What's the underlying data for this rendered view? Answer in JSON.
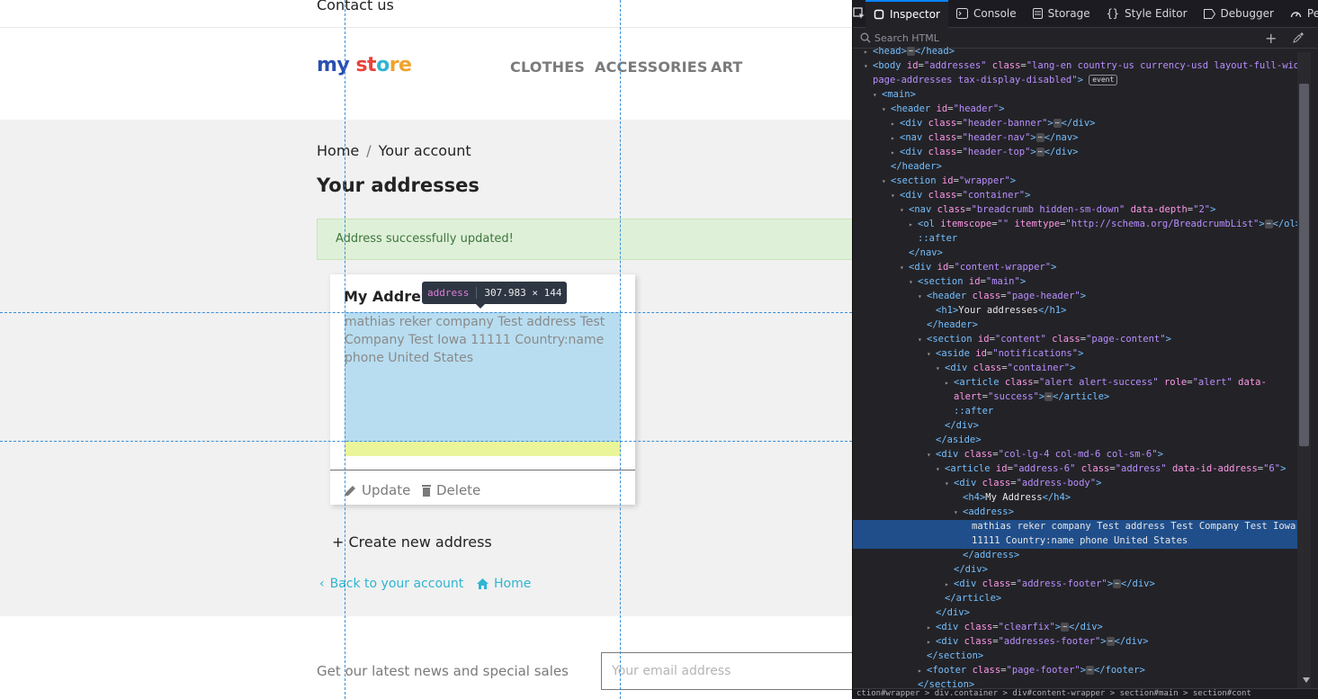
{
  "site": {
    "contact": "Contact us",
    "logo": {
      "part1": "my",
      "part2": "st",
      "part3": "o",
      "part4": "re"
    },
    "menu": [
      "CLOTHES",
      "ACCESSORIES",
      "ART"
    ],
    "breadcrumb": {
      "home": "Home",
      "sep": "/",
      "current": "Your account"
    },
    "page_title": "Your addresses",
    "alert": "Address successfully updated!",
    "address_card": {
      "title": "My Address",
      "body": "mathias reker company Test address Test Company Test Iowa 11111 Country:name phone United States",
      "update": "Update",
      "delete": "Delete"
    },
    "create_new": "Create new address",
    "back_link": "Back to your account",
    "home_link": "Home",
    "newsletter": "Get our latest news and special sales",
    "email_placeholder": "Your email address"
  },
  "overlay": {
    "tooltip_tag": "address",
    "tooltip_dims": "307.983 × 144"
  },
  "devtools": {
    "tabs": [
      "Inspector",
      "Console",
      "Storage",
      "Style Editor",
      "Debugger",
      "Perf"
    ],
    "search_placeholder": "Search HTML",
    "breadcrumb_bar": "ction#wrapper > div.container > div#content-wrapper > section#main > section#cont",
    "tree": [
      {
        "indent": 1,
        "tw": "▸",
        "html": "<span class='tg'>&lt;head&gt;</span><span class='dots'>⋯</span><span class='tg'>&lt;/head&gt;</span>"
      },
      {
        "indent": 1,
        "tw": "▾",
        "html": "<span class='tg'>&lt;body</span> <span class='an'>id</span>=<span class='av'>\"addresses\"</span> <span class='an'>class</span>=<span class='av'>\"lang-en country-us currency-usd layout-full-width</span>"
      },
      {
        "indent": 1,
        "tw": "",
        "html": "<span class='av'>page-addresses tax-display-disabled\"</span><span class='tg'>&gt;</span> <span class='badge'>event</span>"
      },
      {
        "indent": 2,
        "tw": "▾",
        "html": "<span class='tg'>&lt;main&gt;</span>"
      },
      {
        "indent": 3,
        "tw": "▾",
        "html": "<span class='tg'>&lt;header</span> <span class='an'>id</span>=<span class='av'>\"header\"</span><span class='tg'>&gt;</span>"
      },
      {
        "indent": 4,
        "tw": "▸",
        "html": "<span class='tg'>&lt;div</span> <span class='an'>class</span>=<span class='av'>\"header-banner\"</span><span class='tg'>&gt;</span><span class='dots'>⋯</span><span class='tg'>&lt;/div&gt;</span>"
      },
      {
        "indent": 4,
        "tw": "▸",
        "html": "<span class='tg'>&lt;nav</span> <span class='an'>class</span>=<span class='av'>\"header-nav\"</span><span class='tg'>&gt;</span><span class='dots'>⋯</span><span class='tg'>&lt;/nav&gt;</span>"
      },
      {
        "indent": 4,
        "tw": "▸",
        "html": "<span class='tg'>&lt;div</span> <span class='an'>class</span>=<span class='av'>\"header-top\"</span><span class='tg'>&gt;</span><span class='dots'>⋯</span><span class='tg'>&lt;/div&gt;</span>"
      },
      {
        "indent": 3,
        "tw": "",
        "html": "<span class='tg'>&lt;/header&gt;</span>"
      },
      {
        "indent": 3,
        "tw": "▾",
        "html": "<span class='tg'>&lt;section</span> <span class='an'>id</span>=<span class='av'>\"wrapper\"</span><span class='tg'>&gt;</span>"
      },
      {
        "indent": 4,
        "tw": "▾",
        "html": "<span class='tg'>&lt;div</span> <span class='an'>class</span>=<span class='av'>\"container\"</span><span class='tg'>&gt;</span>"
      },
      {
        "indent": 5,
        "tw": "▾",
        "html": "<span class='tg'>&lt;nav</span> <span class='an'>class</span>=<span class='av'>\"breadcrumb hidden-sm-down\"</span> <span class='an'>data-depth</span>=<span class='av'>\"2\"</span><span class='tg'>&gt;</span>"
      },
      {
        "indent": 6,
        "tw": "▸",
        "html": "<span class='tg'>&lt;ol</span> <span class='an'>itemscope</span>=<span class='av'>\"\"</span> <span class='an'>itemtype</span>=<span class='av'>\"http://schema.org/BreadcrumbList\"</span><span class='tg'>&gt;</span><span class='dots'>⋯</span><span class='tg'>&lt;/ol&gt;</span>"
      },
      {
        "indent": 6,
        "tw": "",
        "html": "<span class='ps'>::after</span>"
      },
      {
        "indent": 5,
        "tw": "",
        "html": "<span class='tg'>&lt;/nav&gt;</span>"
      },
      {
        "indent": 5,
        "tw": "▾",
        "html": "<span class='tg'>&lt;div</span> <span class='an'>id</span>=<span class='av'>\"content-wrapper\"</span><span class='tg'>&gt;</span>"
      },
      {
        "indent": 6,
        "tw": "▾",
        "html": "<span class='tg'>&lt;section</span> <span class='an'>id</span>=<span class='av'>\"main\"</span><span class='tg'>&gt;</span>"
      },
      {
        "indent": 7,
        "tw": "▾",
        "html": "<span class='tg'>&lt;header</span> <span class='an'>class</span>=<span class='av'>\"page-header\"</span><span class='tg'>&gt;</span>"
      },
      {
        "indent": 8,
        "tw": "",
        "html": "<span class='tg'>&lt;h1&gt;</span><span class='tx'>Your addresses</span><span class='tg'>&lt;/h1&gt;</span>"
      },
      {
        "indent": 7,
        "tw": "",
        "html": "<span class='tg'>&lt;/header&gt;</span>"
      },
      {
        "indent": 7,
        "tw": "▾",
        "html": "<span class='tg'>&lt;section</span> <span class='an'>id</span>=<span class='av'>\"content\"</span> <span class='an'>class</span>=<span class='av'>\"page-content\"</span><span class='tg'>&gt;</span>"
      },
      {
        "indent": 8,
        "tw": "▾",
        "html": "<span class='tg'>&lt;aside</span> <span class='an'>id</span>=<span class='av'>\"notifications\"</span><span class='tg'>&gt;</span>"
      },
      {
        "indent": 9,
        "tw": "▾",
        "html": "<span class='tg'>&lt;div</span> <span class='an'>class</span>=<span class='av'>\"container\"</span><span class='tg'>&gt;</span>"
      },
      {
        "indent": 10,
        "tw": "▸",
        "html": "<span class='tg'>&lt;article</span> <span class='an'>class</span>=<span class='av'>\"alert alert-success\"</span> <span class='an'>role</span>=<span class='av'>\"alert\"</span> <span class='an'>data-</span>"
      },
      {
        "indent": 10,
        "tw": "",
        "html": "<span class='an'>alert</span>=<span class='av'>\"success\"</span><span class='tg'>&gt;</span><span class='dots'>⋯</span><span class='tg'>&lt;/article&gt;</span>"
      },
      {
        "indent": 10,
        "tw": "",
        "html": "<span class='ps'>::after</span>"
      },
      {
        "indent": 9,
        "tw": "",
        "html": "<span class='tg'>&lt;/div&gt;</span>"
      },
      {
        "indent": 8,
        "tw": "",
        "html": "<span class='tg'>&lt;/aside&gt;</span>"
      },
      {
        "indent": 8,
        "tw": "▾",
        "html": "<span class='tg'>&lt;div</span> <span class='an'>class</span>=<span class='av'>\"col-lg-4 col-md-6 col-sm-6\"</span><span class='tg'>&gt;</span>"
      },
      {
        "indent": 9,
        "tw": "▾",
        "html": "<span class='tg'>&lt;article</span> <span class='an'>id</span>=<span class='av'>\"address-6\"</span> <span class='an'>class</span>=<span class='av'>\"address\"</span> <span class='an'>data-id-address</span>=<span class='av'>\"6\"</span><span class='tg'>&gt;</span>"
      },
      {
        "indent": 10,
        "tw": "▾",
        "html": "<span class='tg'>&lt;div</span> <span class='an'>class</span>=<span class='av'>\"address-body\"</span><span class='tg'>&gt;</span>"
      },
      {
        "indent": 11,
        "tw": "",
        "html": "<span class='tg'>&lt;h4&gt;</span><span class='tx'>My Address</span><span class='tg'>&lt;/h4&gt;</span>"
      },
      {
        "indent": 11,
        "tw": "▾",
        "html": "<span class='tg'>&lt;address&gt;</span>"
      },
      {
        "indent": 12,
        "tw": "",
        "sel": true,
        "html": "<span class='tx'>mathias reker company Test address Test Company Test Iowa</span>"
      },
      {
        "indent": 12,
        "tw": "",
        "sel": true,
        "html": "<span class='tx'>11111 Country:name phone United States</span>"
      },
      {
        "indent": 11,
        "tw": "",
        "html": "<span class='tg'>&lt;/address&gt;</span>"
      },
      {
        "indent": 10,
        "tw": "",
        "html": "<span class='tg'>&lt;/div&gt;</span>"
      },
      {
        "indent": 10,
        "tw": "▸",
        "html": "<span class='tg'>&lt;div</span> <span class='an'>class</span>=<span class='av'>\"address-footer\"</span><span class='tg'>&gt;</span><span class='dots'>⋯</span><span class='tg'>&lt;/div&gt;</span>"
      },
      {
        "indent": 9,
        "tw": "",
        "html": "<span class='tg'>&lt;/article&gt;</span>"
      },
      {
        "indent": 8,
        "tw": "",
        "html": "<span class='tg'>&lt;/div&gt;</span>"
      },
      {
        "indent": 8,
        "tw": "▸",
        "html": "<span class='tg'>&lt;div</span> <span class='an'>class</span>=<span class='av'>\"clearfix\"</span><span class='tg'>&gt;</span><span class='dots'>⋯</span><span class='tg'>&lt;/div&gt;</span>"
      },
      {
        "indent": 8,
        "tw": "▸",
        "html": "<span class='tg'>&lt;div</span> <span class='an'>class</span>=<span class='av'>\"addresses-footer\"</span><span class='tg'>&gt;</span><span class='dots'>⋯</span><span class='tg'>&lt;/div&gt;</span>"
      },
      {
        "indent": 7,
        "tw": "",
        "html": "<span class='tg'>&lt;/section&gt;</span>"
      },
      {
        "indent": 7,
        "tw": "▸",
        "html": "<span class='tg'>&lt;footer</span> <span class='an'>class</span>=<span class='av'>\"page-footer\"</span><span class='tg'>&gt;</span><span class='dots'>⋯</span><span class='tg'>&lt;/footer&gt;</span>"
      },
      {
        "indent": 6,
        "tw": "",
        "html": "<span class='tg'>&lt;/section&gt;</span>"
      }
    ]
  }
}
